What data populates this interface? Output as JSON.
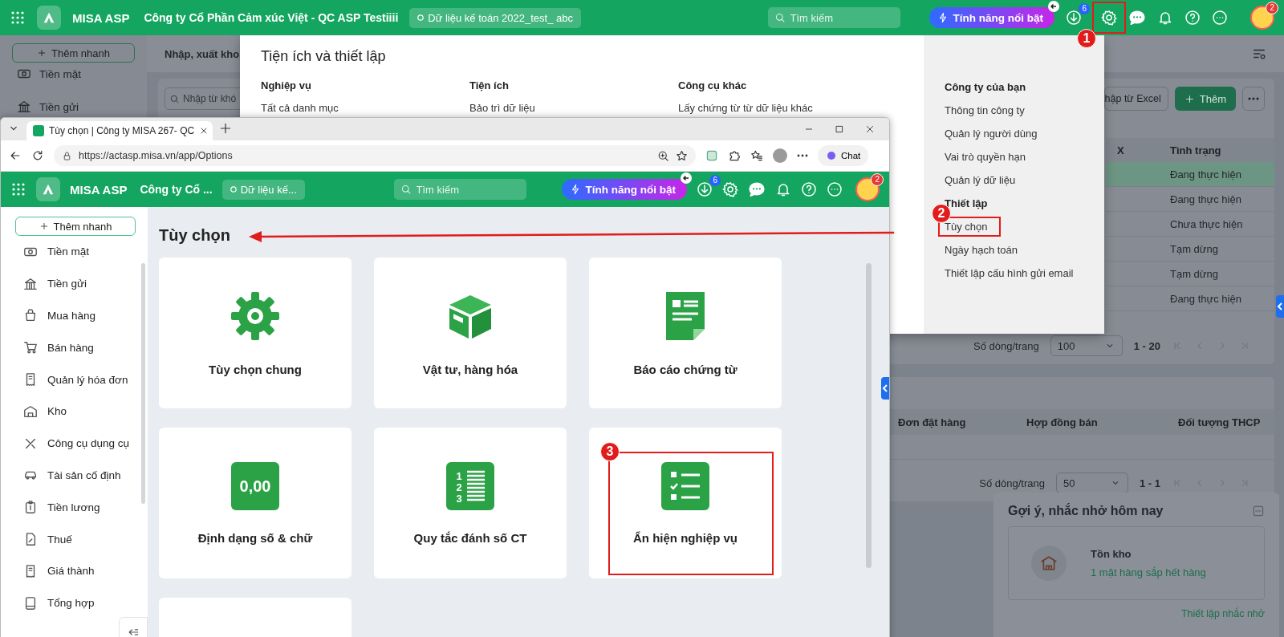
{
  "app": {
    "topbar": {
      "brand": "MISA ASP",
      "company": "Công ty Cổ Phần Cảm xúc Việt - QC ASP Testiiii",
      "database": "Dữ liệu kế toán 2022_test_ abc",
      "search_placeholder": "Tìm kiếm",
      "feature_button": "Tính năng nổi bật",
      "download_badge": "6",
      "settings_callout": "1",
      "avatar_badge": "2"
    },
    "sidebar": {
      "quick_add": "Thêm nhanh",
      "items": [
        {
          "label": "Tiền mặt",
          "kind": "cash"
        },
        {
          "label": "Tiền gửi",
          "kind": "bank"
        }
      ]
    },
    "tab": "Nhập, xuất kho",
    "search_placeholder": "Nhập từ khó",
    "import_button": "hập từ Excel",
    "add_button": "Thêm",
    "table": {
      "columns": [
        "X",
        "Tình trạng"
      ],
      "rows": [
        {
          "status": "Đang thực hiện",
          "selected": true
        },
        {
          "status": "Đang thực hiện",
          "selected": false
        },
        {
          "status": "Chưa thực hiện",
          "selected": false
        },
        {
          "status": "Tạm dừng",
          "selected": false
        },
        {
          "status": "Tạm dừng",
          "selected": false
        },
        {
          "status": "Đang thực hiện",
          "selected": false
        }
      ]
    },
    "pagination": {
      "label": "Số dòng/trang",
      "page_size": "100",
      "range": "1 - 20"
    },
    "table_2": {
      "columns": [
        "Đơn đặt hàng",
        "Hợp đồng bán",
        "Đối tượng THCP"
      ]
    },
    "pagination_2": {
      "label": "Số dòng/trang",
      "page_size": "50",
      "range": "1 - 1"
    },
    "reminder": {
      "title": "Gợi ý, nhắc nhở hôm nay",
      "item_title": "Tồn kho",
      "item_text": "1 mặt hàng sắp hết hàng",
      "link": "Thiết lập nhắc nhở"
    }
  },
  "settings_menu": {
    "title": "Tiện ích và thiết lập",
    "columns": [
      {
        "heading": "Nghiệp vụ",
        "items": [
          "Tất cả danh mục"
        ]
      },
      {
        "heading": "Tiện ích",
        "items": [
          "Bảo trì dữ liệu"
        ]
      },
      {
        "heading": "Công cụ khác",
        "items": [
          "Lấy chứng từ từ dữ liệu khác"
        ]
      }
    ],
    "side_groups": [
      {
        "heading": "Công ty của bạn",
        "items": [
          {
            "label": "Thông tin công ty"
          },
          {
            "label": "Quản lý người dùng"
          },
          {
            "label": "Vai trò quyền hạn"
          },
          {
            "label": "Quản lý dữ liệu"
          }
        ]
      },
      {
        "heading": "Thiết lập",
        "items": [
          {
            "label": "Tùy chọn",
            "callout": "2"
          },
          {
            "label": "Ngày hạch toán"
          },
          {
            "label": "Thiết lập cấu hình gửi email"
          }
        ]
      }
    ]
  },
  "browser": {
    "tab_title": "Tùy chọn | Công ty MISA 267- QC",
    "url": "https://actasp.misa.vn/app/Options",
    "chat_button": "Chat",
    "app": {
      "topbar": {
        "brand": "MISA ASP",
        "company": "Công ty Cổ ...",
        "database": "Dữ liệu kế...",
        "search_placeholder": "Tìm kiếm",
        "feature_button": "Tính năng nổi bật",
        "download_badge": "6",
        "avatar_badge": "2"
      },
      "sidebar": {
        "quick_add": "Thêm nhanh",
        "items": [
          {
            "label": "Tiền mặt",
            "kind": "cash"
          },
          {
            "label": "Tiền gửi",
            "kind": "bank"
          },
          {
            "label": "Mua hàng",
            "kind": "bag"
          },
          {
            "label": "Bán hàng",
            "kind": "cart"
          },
          {
            "label": "Quản lý hóa đơn",
            "kind": "receipt"
          },
          {
            "label": "Kho",
            "kind": "warehouse"
          },
          {
            "label": "Công cụ dụng cụ",
            "kind": "tools"
          },
          {
            "label": "Tài sản cố định",
            "kind": "car"
          },
          {
            "label": "Tiền lương",
            "kind": "clipboard"
          },
          {
            "label": "Thuế",
            "kind": "doc"
          },
          {
            "label": "Giá thành",
            "kind": "receipt"
          },
          {
            "label": "Tổng hợp",
            "kind": "book"
          }
        ]
      },
      "page_title": "Tùy chọn",
      "cards": [
        {
          "kind": "gear",
          "title": "Tùy chọn chung"
        },
        {
          "kind": "box",
          "title": "Vật tư, hàng hóa"
        },
        {
          "kind": "document",
          "title": "Báo cáo chứng từ"
        },
        {
          "kind": "number",
          "title": "Định dạng số & chữ",
          "icon_text": "0,00"
        },
        {
          "kind": "numbered",
          "title": "Quy tắc đánh số CT",
          "icon_digits": [
            "1",
            "2",
            "3"
          ]
        },
        {
          "kind": "checklist",
          "title": "Ẩn hiện nghiệp vụ",
          "callout": "3"
        },
        {
          "kind": "blank"
        }
      ]
    }
  }
}
